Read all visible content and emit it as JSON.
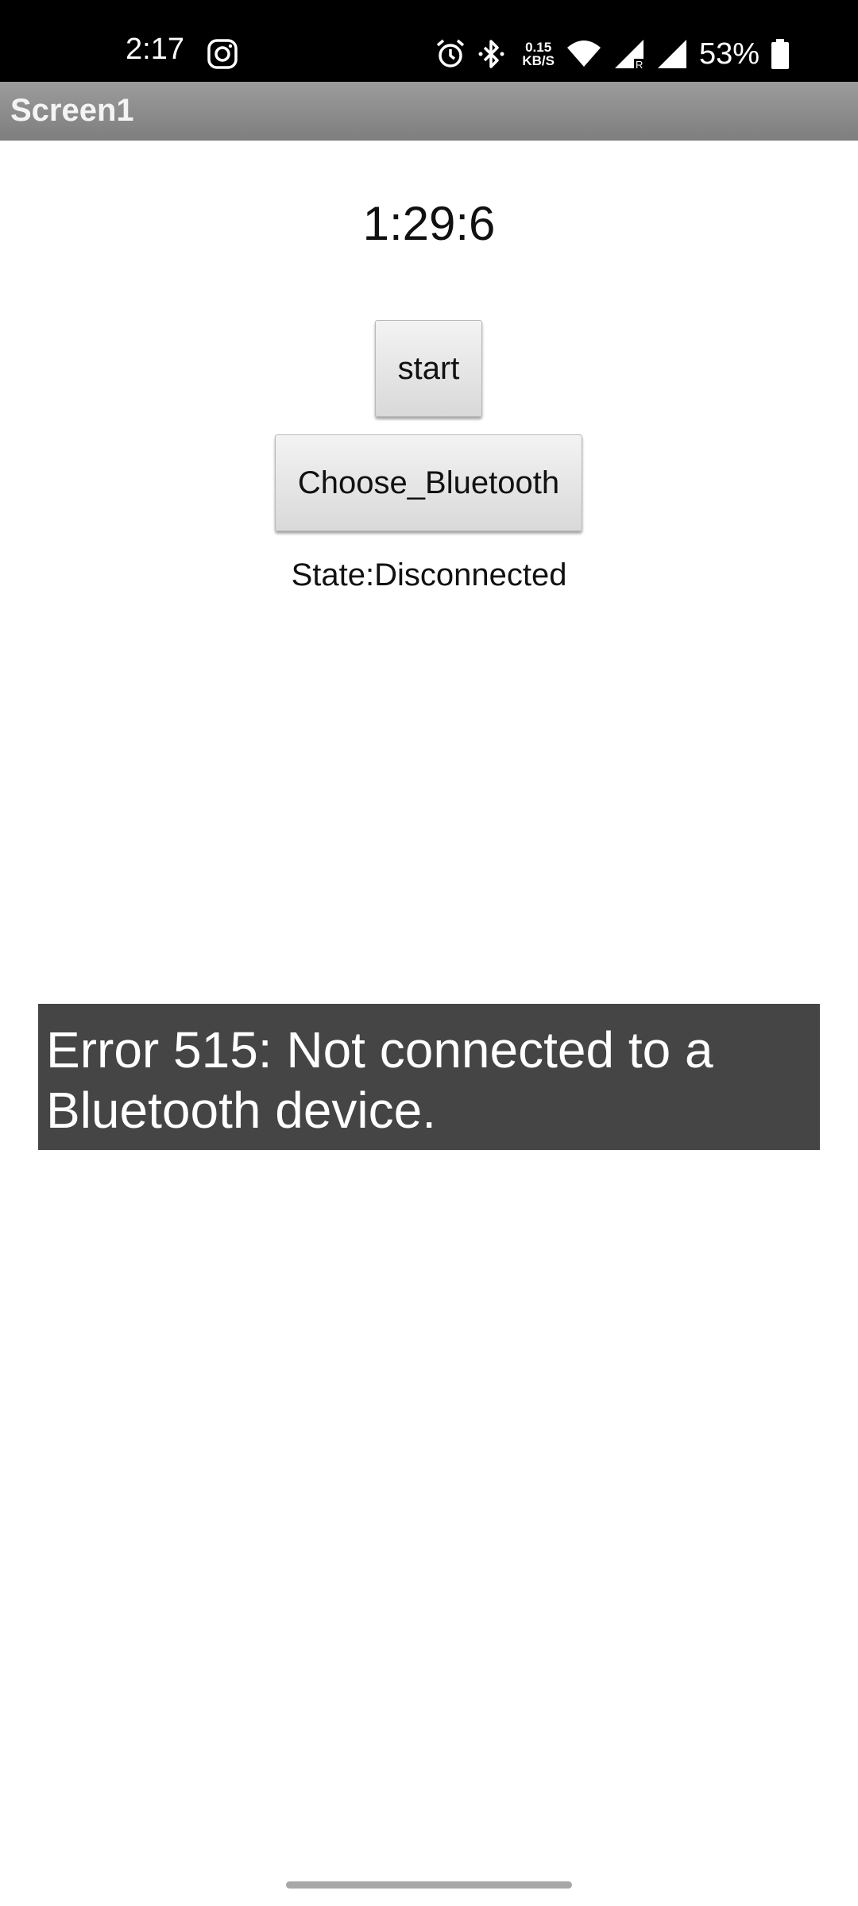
{
  "status_bar": {
    "time": "2:17",
    "net_speed_value": "0.15",
    "net_speed_unit": "KB/S",
    "battery_percent": "53%",
    "icons": [
      "instagram-icon",
      "alarm-icon",
      "bluetooth-icon",
      "wifi-icon",
      "signal-icon",
      "signal-icon",
      "battery-icon"
    ]
  },
  "title_bar": {
    "title": "Screen1"
  },
  "main": {
    "timer_text": "1:29:6",
    "start_label": "start",
    "choose_bluetooth_label": "Choose_Bluetooth",
    "state_text": "State:Disconnected"
  },
  "toast": {
    "message": "Error 515: Not connected to a Bluetooth device."
  },
  "colors": {
    "status_bar_bg": "#000000",
    "title_bar_bg": "#8a8a8a",
    "toast_bg": "#454545"
  }
}
